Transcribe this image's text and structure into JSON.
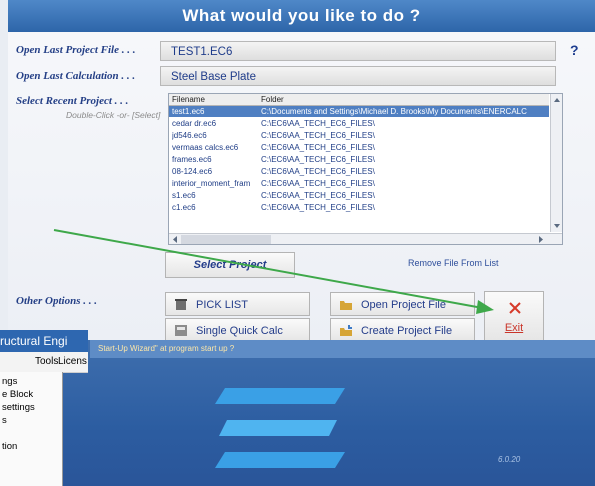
{
  "title": "What would you like to do ?",
  "help_label": "?",
  "labels": {
    "last_project": "Open Last Project File . . .",
    "last_calc": "Open Last Calculation . . .",
    "recent": "Select Recent Project . . .",
    "recent_hint": "Double-Click -or- [Select]",
    "other": "Other Options . . ."
  },
  "fields": {
    "last_project": "TEST1.EC6",
    "last_calc": "Steel Base Plate"
  },
  "file_list": {
    "headers": [
      "Filename",
      "Folder"
    ],
    "rows": [
      {
        "name": "test1.ec6",
        "folder": "C:\\Documents and Settings\\Michael D. Brooks\\My Documents\\ENERCALC"
      },
      {
        "name": "cedar dr.ec6",
        "folder": "C:\\EC6\\AA_TECH_EC6_FILES\\"
      },
      {
        "name": "jd546.ec6",
        "folder": "C:\\EC6\\AA_TECH_EC6_FILES\\"
      },
      {
        "name": "vermaas calcs.ec6",
        "folder": "C:\\EC6\\AA_TECH_EC6_FILES\\"
      },
      {
        "name": "frames.ec6",
        "folder": "C:\\EC6\\AA_TECH_EC6_FILES\\"
      },
      {
        "name": "08-124.ec6",
        "folder": "C:\\EC6\\AA_TECH_EC6_FILES\\"
      },
      {
        "name": "interior_moment_fram",
        "folder": "C:\\EC6\\AA_TECH_EC6_FILES\\"
      },
      {
        "name": "s1.ec6",
        "folder": "C:\\EC6\\AA_TECH_EC6_FILES\\"
      },
      {
        "name": "c1.ec6",
        "folder": "C:\\EC6\\AA_TECH_EC6_FILES\\"
      }
    ],
    "selected_index": 0
  },
  "buttons": {
    "select_project": "Select Project",
    "remove_file": "Remove File From List",
    "pick_list": "PICK LIST",
    "single_calc": "Single Quick Calc",
    "open_project": "Open Project File",
    "create_project": "Create Project File",
    "exit": "Exit"
  },
  "background": {
    "window_title": "ructural Engi",
    "startup_text": "Start-Up Wizard\" at program start up ?",
    "menu_bar": [
      "Tools",
      "Licens"
    ],
    "menu_items": [
      "ngs",
      "e Block",
      "settings",
      "s",
      "tion"
    ],
    "version": "6.0.20"
  },
  "icons": {
    "pick_list": "trash-bin-icon",
    "single_calc": "calculator-icon",
    "open_project": "open-folder-icon",
    "create_project": "create-project-icon",
    "exit": "close-x-icon"
  },
  "colors": {
    "title_bar": "#2d65a9",
    "label_text": "#243f86",
    "selected_row": "#4f7fc2",
    "exit_x": "#d63a2a",
    "arrow": "#3ea84a"
  }
}
